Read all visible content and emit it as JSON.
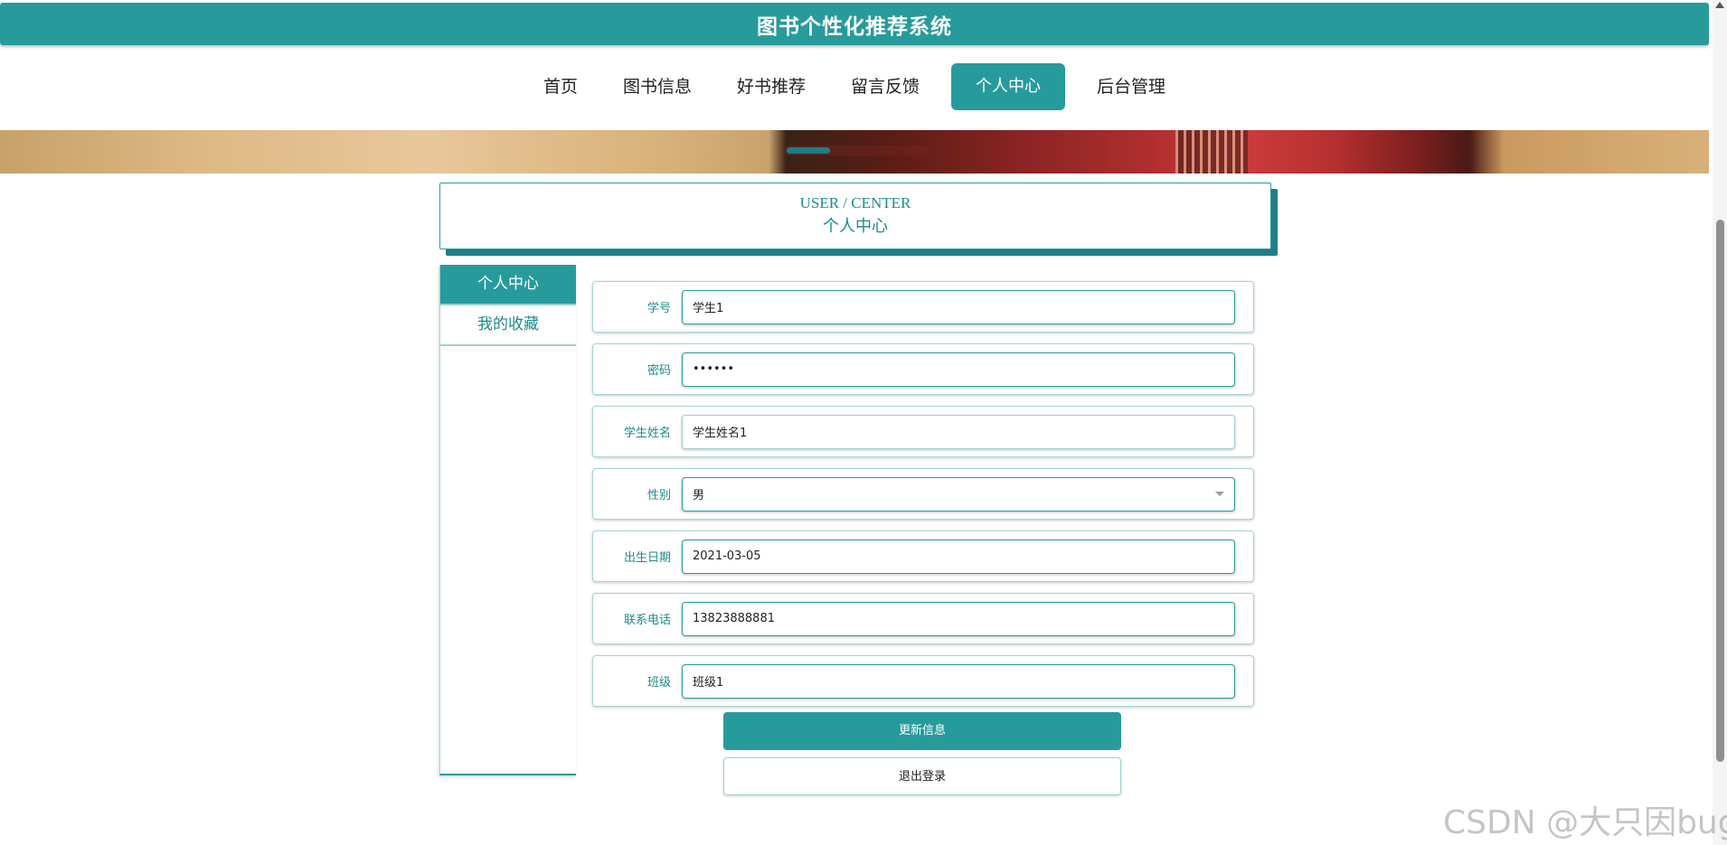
{
  "header": {
    "title": "图书个性化推荐系统"
  },
  "nav": {
    "items": [
      {
        "label": "首页"
      },
      {
        "label": "图书信息"
      },
      {
        "label": "好书推荐"
      },
      {
        "label": "留言反馈"
      },
      {
        "label": "个人中心",
        "active": true
      },
      {
        "label": "后台管理"
      }
    ]
  },
  "section_header": {
    "en": "USER / CENTER",
    "cn": "个人中心"
  },
  "sidebar": {
    "items": [
      {
        "label": "个人中心",
        "active": true
      },
      {
        "label": "我的收藏"
      }
    ]
  },
  "form": {
    "student_id": {
      "label": "学号",
      "value": "学生1"
    },
    "password": {
      "label": "密码",
      "value": "••••••"
    },
    "student_name": {
      "label": "学生姓名",
      "value": "学生姓名1"
    },
    "gender": {
      "label": "性别",
      "value": "男"
    },
    "birth_date": {
      "label": "出生日期",
      "value": "2021-03-05"
    },
    "phone": {
      "label": "联系电话",
      "value": "13823888881"
    },
    "class": {
      "label": "班级",
      "value": "班级1"
    }
  },
  "buttons": {
    "update": "更新信息",
    "logout": "退出登录"
  },
  "watermark": "CSDN @大只因bug",
  "colors": {
    "accent": "#279b9c",
    "accent_dark": "#1f7e86"
  }
}
